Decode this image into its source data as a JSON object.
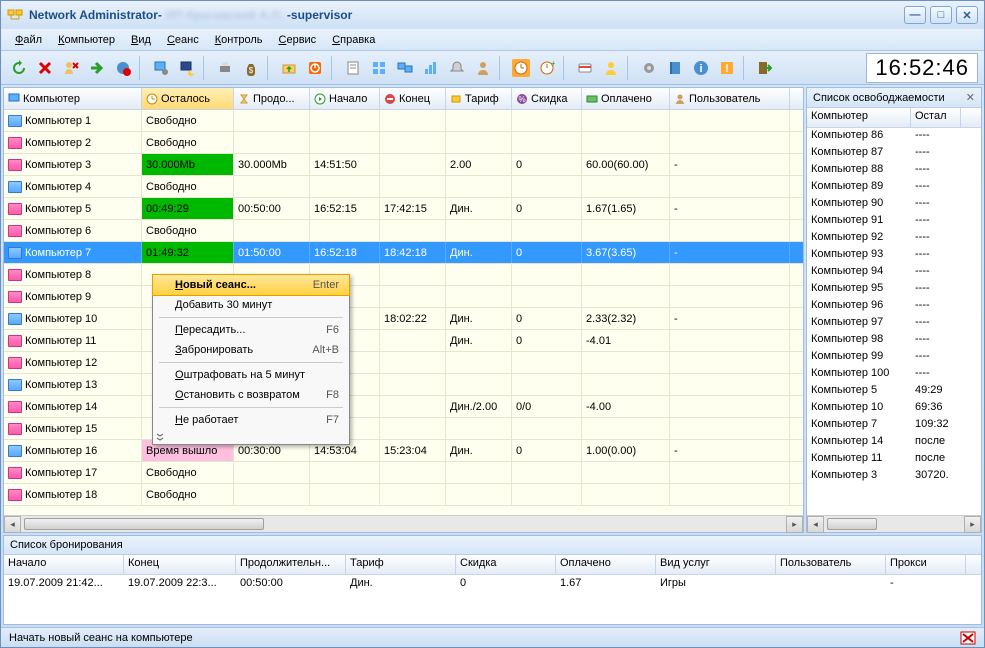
{
  "window": {
    "title_app": "Network Administrator",
    "title_blur": "ИП Красавский А.Л.",
    "title_role": "supervisor"
  },
  "menu": [
    "Файл",
    "Компьютер",
    "Вид",
    "Сеанс",
    "Контроль",
    "Сервис",
    "Справка"
  ],
  "clock": "16:52:46",
  "toolbar_icons": [
    "refresh-icon",
    "delete-icon",
    "remove-user-icon",
    "arrow-right-icon",
    "globe-stop-icon",
    "monitor-gear-icon",
    "monitor-moon-icon",
    "printer-icon",
    "money-bag-icon",
    "folder-up-icon",
    "power-icon",
    "report-icon",
    "grid-icon",
    "monitors-icon",
    "chart-icon",
    "bell-icon",
    "person-icon",
    "alarm-active-icon",
    "alarm-add-icon",
    "card-icon",
    "user-yellow-icon",
    "gear-icon",
    "book-icon",
    "info-icon",
    "warning-icon",
    "exit-icon"
  ],
  "columns": [
    {
      "label": "Компьютер",
      "icon": "monitor-icon"
    },
    {
      "label": "Осталось",
      "icon": "clock-icon",
      "selected": true
    },
    {
      "label": "Продо...",
      "icon": "hourglass-icon"
    },
    {
      "label": "Начало",
      "icon": "clock-start-icon"
    },
    {
      "label": "Конец",
      "icon": "stop-icon"
    },
    {
      "label": "Тариф",
      "icon": "price-icon"
    },
    {
      "label": "Скидка",
      "icon": "discount-icon"
    },
    {
      "label": "Оплачено",
      "icon": "paid-icon"
    },
    {
      "label": "Пользователь",
      "icon": "user-icon"
    }
  ],
  "rows": [
    {
      "name": "Компьютер 1",
      "status": "Свободно"
    },
    {
      "name": "Компьютер 2",
      "status": "Свободно"
    },
    {
      "name": "Компьютер 3",
      "status": "30.000Mb",
      "status_color": "green",
      "dur": "30.000Mb",
      "start": "14:51:50",
      "end": "",
      "tariff": "2.00",
      "disc": "0",
      "paid": "60.00(60.00)",
      "user": "-"
    },
    {
      "name": "Компьютер 4",
      "status": "Свободно"
    },
    {
      "name": "Компьютер 5",
      "status": "00:49:29",
      "status_color": "green",
      "dur": "00:50:00",
      "start": "16:52:15",
      "end": "17:42:15",
      "tariff": "Дин.",
      "disc": "0",
      "paid": "1.67(1.65)",
      "user": "-"
    },
    {
      "name": "Компьютер 6",
      "status": "Свободно"
    },
    {
      "name": "Компьютер 7",
      "status": "01:49:32",
      "status_color": "green",
      "dur": "01:50:00",
      "start": "16:52:18",
      "end": "18:42:18",
      "tariff": "Дин.",
      "disc": "0",
      "paid": "3.67(3.65)",
      "user": "-",
      "selected": true
    },
    {
      "name": "Компьютер 8"
    },
    {
      "name": "Компьютер 9"
    },
    {
      "name": "Компьютер 10",
      "name_hl": true,
      "dur": "",
      "start": "52:22",
      "end": "18:02:22",
      "tariff": "Дин.",
      "disc": "0",
      "paid": "2.33(2.32)",
      "user": "-"
    },
    {
      "name": "Компьютер 11",
      "dur": "",
      "start": "52:19",
      "end": "",
      "tariff": "Дин.",
      "disc": "0",
      "paid": "-4.01",
      "user": ""
    },
    {
      "name": "Компьютер 12"
    },
    {
      "name": "Компьютер 13",
      "name_hl": true
    },
    {
      "name": "Компьютер 14",
      "dur": "",
      "start": "52:39",
      "end": "",
      "tariff": "Дин./2.00",
      "disc": "0/0",
      "paid": "-4.00",
      "user": ""
    },
    {
      "name": "Компьютер 15"
    },
    {
      "name": "Компьютер 16",
      "name_hl": true,
      "status": "Время вышло",
      "status_color": "pink",
      "dur": "00:30:00",
      "start": "14:53:04",
      "end": "15:23:04",
      "tariff": "Дин.",
      "disc": "0",
      "paid": "1.00(0.00)",
      "user": "-"
    },
    {
      "name": "Компьютер 17",
      "status": "Свободно"
    },
    {
      "name": "Компьютер 18",
      "status": "Свободно"
    }
  ],
  "context_menu": {
    "items": [
      {
        "label": "Новый сеанс...",
        "shortcut": "Enter",
        "hl": true
      },
      {
        "label": "Добавить 30 минут"
      },
      {
        "sep": true
      },
      {
        "label": "Пересадить...",
        "shortcut": "F6"
      },
      {
        "label": "Забронировать",
        "shortcut": "Alt+B"
      },
      {
        "sep": true
      },
      {
        "label": "Оштрафовать на 5 минут"
      },
      {
        "label": "Остановить с возвратом",
        "shortcut": "F8"
      },
      {
        "sep": true
      },
      {
        "label": "Не работает",
        "shortcut": "F7"
      }
    ]
  },
  "side_panel": {
    "title": "Список освободжаемости",
    "head": [
      "Компьютер",
      "Остал"
    ],
    "rows": [
      {
        "n": "Компьютер 86",
        "v": "----"
      },
      {
        "n": "Компьютер 87",
        "v": "----"
      },
      {
        "n": "Компьютер 88",
        "v": "----"
      },
      {
        "n": "Компьютер 89",
        "v": "----"
      },
      {
        "n": "Компьютер 90",
        "v": "----"
      },
      {
        "n": "Компьютер 91",
        "v": "----"
      },
      {
        "n": "Компьютер 92",
        "v": "----"
      },
      {
        "n": "Компьютер 93",
        "v": "----"
      },
      {
        "n": "Компьютер 94",
        "v": "----"
      },
      {
        "n": "Компьютер 95",
        "v": "----"
      },
      {
        "n": "Компьютер 96",
        "v": "----"
      },
      {
        "n": "Компьютер 97",
        "v": "----"
      },
      {
        "n": "Компьютер 98",
        "v": "----"
      },
      {
        "n": "Компьютер 99",
        "v": "----"
      },
      {
        "n": "Компьютер 100",
        "v": "----"
      },
      {
        "n": "Компьютер 5",
        "v": "49:29"
      },
      {
        "n": "Компьютер 10",
        "v": "69:36"
      },
      {
        "n": "Компьютер 7",
        "v": "109:32"
      },
      {
        "n": "Компьютер 14",
        "v": "после"
      },
      {
        "n": "Компьютер 11",
        "v": "после"
      },
      {
        "n": "Компьютер 3",
        "v": "30720."
      }
    ]
  },
  "booking": {
    "title": "Список бронирования",
    "headers": [
      "Начало",
      "Конец",
      "Продолжительн...",
      "Тариф",
      "Скидка",
      "Оплачено",
      "Вид услуг",
      "Пользователь",
      "Прокси"
    ],
    "row": [
      "19.07.2009 21:42...",
      "19.07.2009 22:3...",
      "00:50:00",
      "Дин.",
      "0",
      "1.67",
      "Игры",
      "",
      "-"
    ]
  },
  "statusbar": "Начать новый сеанс на компьютере"
}
